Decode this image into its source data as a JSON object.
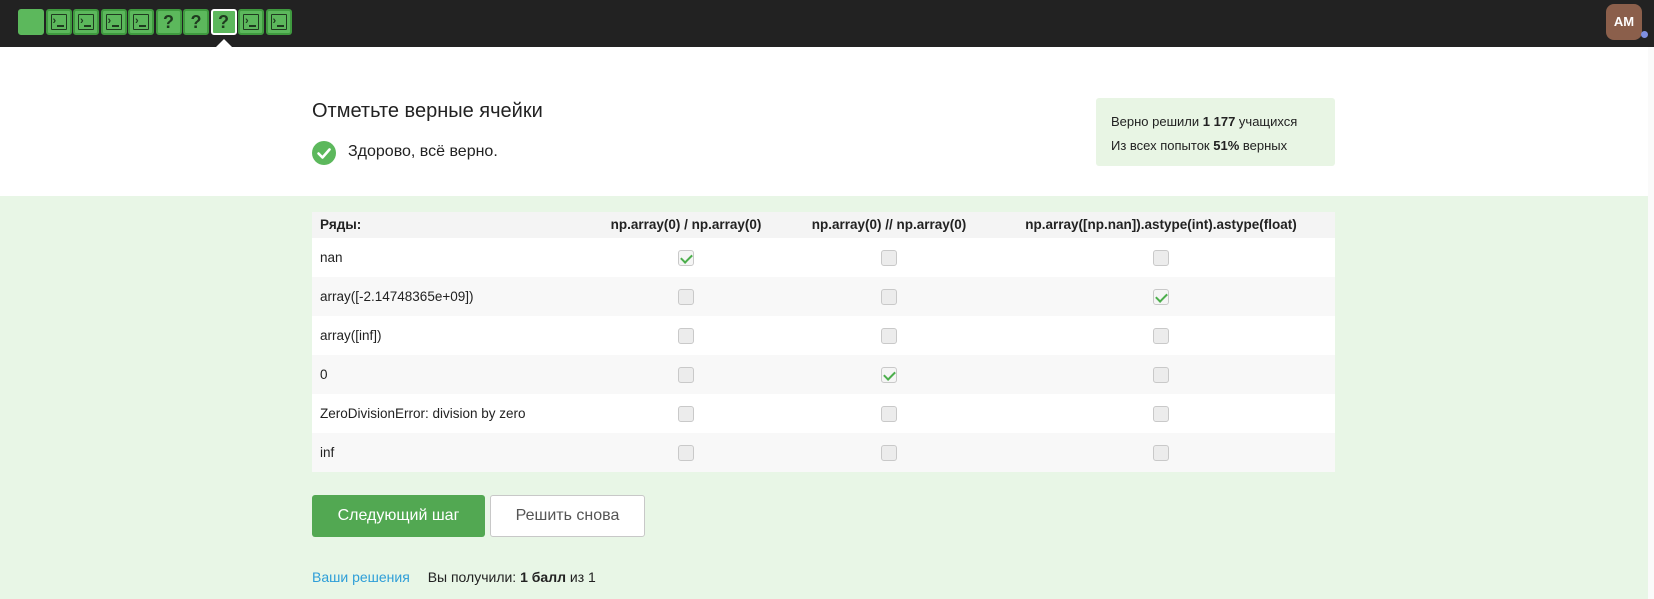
{
  "topbar": {
    "steps": [
      {
        "kind": "plain"
      },
      {
        "kind": "code"
      },
      {
        "kind": "code"
      },
      {
        "kind": "code"
      },
      {
        "kind": "code"
      },
      {
        "kind": "question",
        "glyph": "?"
      },
      {
        "kind": "question",
        "glyph": "?"
      },
      {
        "kind": "question",
        "glyph": "?",
        "active": true
      },
      {
        "kind": "code"
      },
      {
        "kind": "code"
      }
    ],
    "avatar_initials": "AM"
  },
  "task": {
    "title": "Отметьте верные ячейки",
    "feedback": "Здорово, всё верно."
  },
  "stats": {
    "line1_prefix": "Верно решили ",
    "line1_value": "1 177",
    "line1_suffix": " учащихся",
    "line2_prefix": "Из всех попыток ",
    "line2_value": "51%",
    "line2_suffix": " верных"
  },
  "table": {
    "row_header": "Ряды:",
    "columns": [
      "np.array(0) / np.array(0)",
      "np.array(0) // np.array(0)",
      "np.array([np.nan]).astype(int).astype(float)"
    ],
    "rows": [
      {
        "label": "nan",
        "checked": [
          true,
          false,
          false
        ]
      },
      {
        "label": "array([-2.14748365e+09])",
        "checked": [
          false,
          false,
          true
        ]
      },
      {
        "label": "array([inf])",
        "checked": [
          false,
          false,
          false
        ]
      },
      {
        "label": "0",
        "checked": [
          false,
          true,
          false
        ]
      },
      {
        "label": "ZeroDivisionError: division by zero",
        "checked": [
          false,
          false,
          false
        ]
      },
      {
        "label": "inf",
        "checked": [
          false,
          false,
          false
        ]
      }
    ]
  },
  "buttons": {
    "next": "Следующий шаг",
    "again": "Решить снова"
  },
  "footer": {
    "solutions_link": "Ваши решения",
    "got_prefix": "Вы получили: ",
    "got_value": "1 балл",
    "got_suffix": " из 1"
  },
  "colors": {
    "topbar": "#222222",
    "accent_green": "#5cb85c",
    "zone_green": "#e8f6e6",
    "link": "#2e9ed8"
  }
}
